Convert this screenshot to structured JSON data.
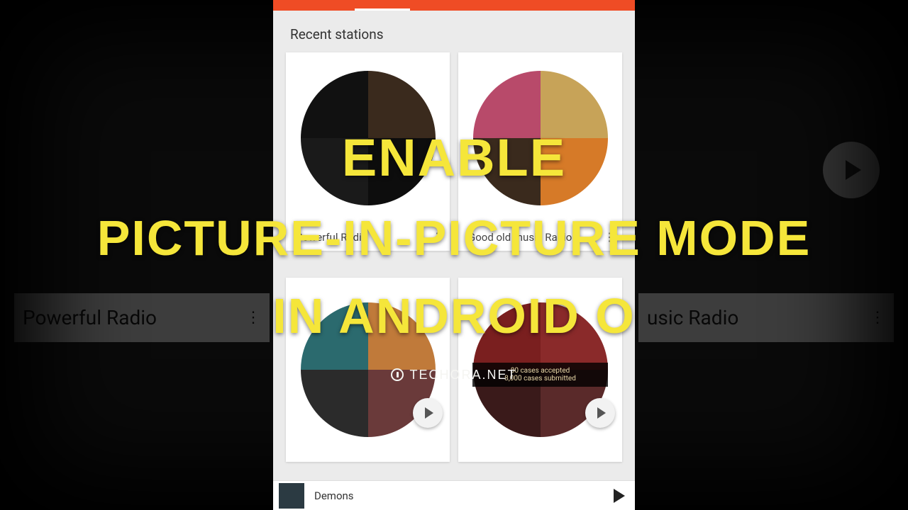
{
  "overlay": {
    "line1": "Enable",
    "line2": "Picture-in-Picture Mode",
    "line3": "in Android O",
    "site": "TECHORA.NET"
  },
  "app": {
    "section_title": "Recent stations",
    "bg_left_label": "Powerful Radio",
    "bg_right_label": "usic  Radio",
    "stations": [
      {
        "name": "Powerful Radio",
        "colors": [
          "#111",
          "#3a2a1d",
          "#1a1a1a",
          "#0d0d0d"
        ]
      },
      {
        "name": "Good old music  Radio",
        "colors": [
          "#b84a6a",
          "#c7a358",
          "#3a2a1d",
          "#d67a28"
        ]
      },
      {
        "name": "",
        "show_play": true,
        "colors": [
          "#2b6a6e",
          "#c07a3a",
          "#2b2b2b",
          "#6a3a3a"
        ]
      },
      {
        "name": "",
        "show_play": true,
        "banner_line1": "80 cases accepted",
        "banner_line2": "8,000 cases submitted",
        "colors": [
          "#7a1f1f",
          "#8a2a2a",
          "#3a1a1a",
          "#5a2a2a"
        ]
      }
    ],
    "nowplaying": {
      "title": "Demons"
    }
  }
}
